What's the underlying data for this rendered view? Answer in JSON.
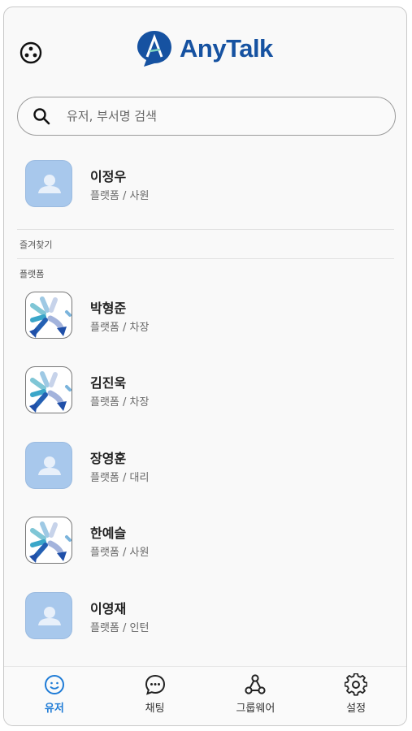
{
  "header": {
    "logo_text": "AnyTalk"
  },
  "search": {
    "placeholder": "유저, 부서명 검색"
  },
  "me": {
    "name": "이정우",
    "sub": "플랫폼 / 사원"
  },
  "sections": {
    "favorites": "즐겨찾기",
    "group": "플랫폼"
  },
  "users": [
    {
      "name": "박형준",
      "sub": "플랫폼 / 차장",
      "avatar": "brand"
    },
    {
      "name": "김진욱",
      "sub": "플랫폼 / 차장",
      "avatar": "brand"
    },
    {
      "name": "장영훈",
      "sub": "플랫폼 / 대리",
      "avatar": "default"
    },
    {
      "name": "한예슬",
      "sub": "플랫폼 / 사원",
      "avatar": "brand"
    },
    {
      "name": "이영재",
      "sub": "플랫폼 / 인턴",
      "avatar": "default"
    }
  ],
  "tabs": [
    {
      "label": "유저",
      "icon": "smile-icon",
      "active": true
    },
    {
      "label": "채팅",
      "icon": "chat-bubble-icon",
      "active": false
    },
    {
      "label": "그룹웨어",
      "icon": "nodes-icon",
      "active": false
    },
    {
      "label": "설정",
      "icon": "gear-icon",
      "active": false
    }
  ],
  "colors": {
    "brand": "#1652a1",
    "active_tab": "#1e7bd6",
    "avatar_default": "#a8c8ec"
  }
}
